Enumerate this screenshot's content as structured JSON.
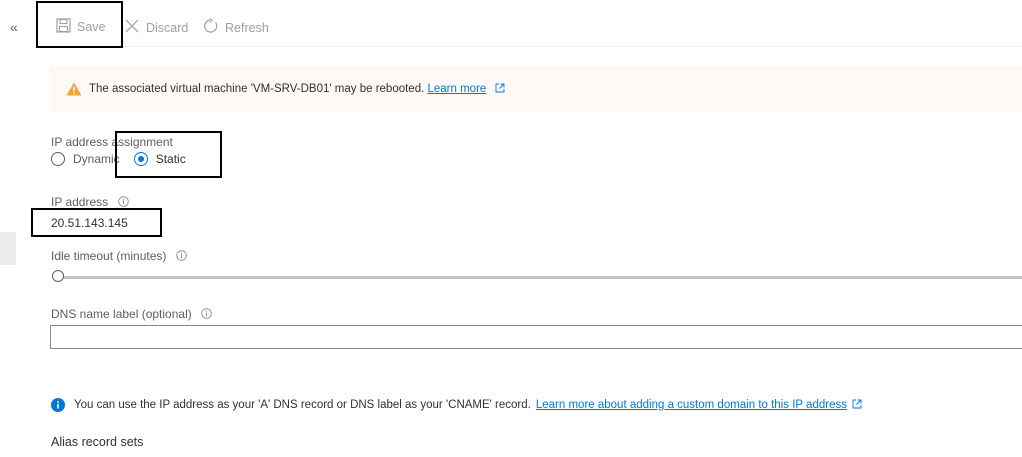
{
  "toolbar": {
    "save_label": "Save",
    "discard_label": "Discard",
    "refresh_label": "Refresh"
  },
  "collapse_glyph": "«",
  "warning": {
    "text": "The associated virtual machine 'VM-SRV-DB01' may be rebooted.",
    "link": "Learn more",
    "color": "#f2a23a"
  },
  "ip_assignment": {
    "label": "IP address assignment",
    "options": [
      "Dynamic",
      "Static"
    ],
    "selected": "Static"
  },
  "ip_address": {
    "label": "IP address",
    "value": "20.51.143.145"
  },
  "idle_timeout": {
    "label": "Idle timeout (minutes)"
  },
  "dns_label": {
    "label": "DNS name label (optional)",
    "value": ""
  },
  "info_note": {
    "text": "You can use the IP address as your 'A' DNS record or DNS label as your 'CNAME' record.",
    "link": "Learn more about adding a custom domain to this IP address"
  },
  "alias": {
    "heading": "Alias record sets"
  },
  "colors": {
    "accent": "#0078d4",
    "warning_bg": "#fff9f5",
    "disabled_text": "#a19f9d"
  }
}
